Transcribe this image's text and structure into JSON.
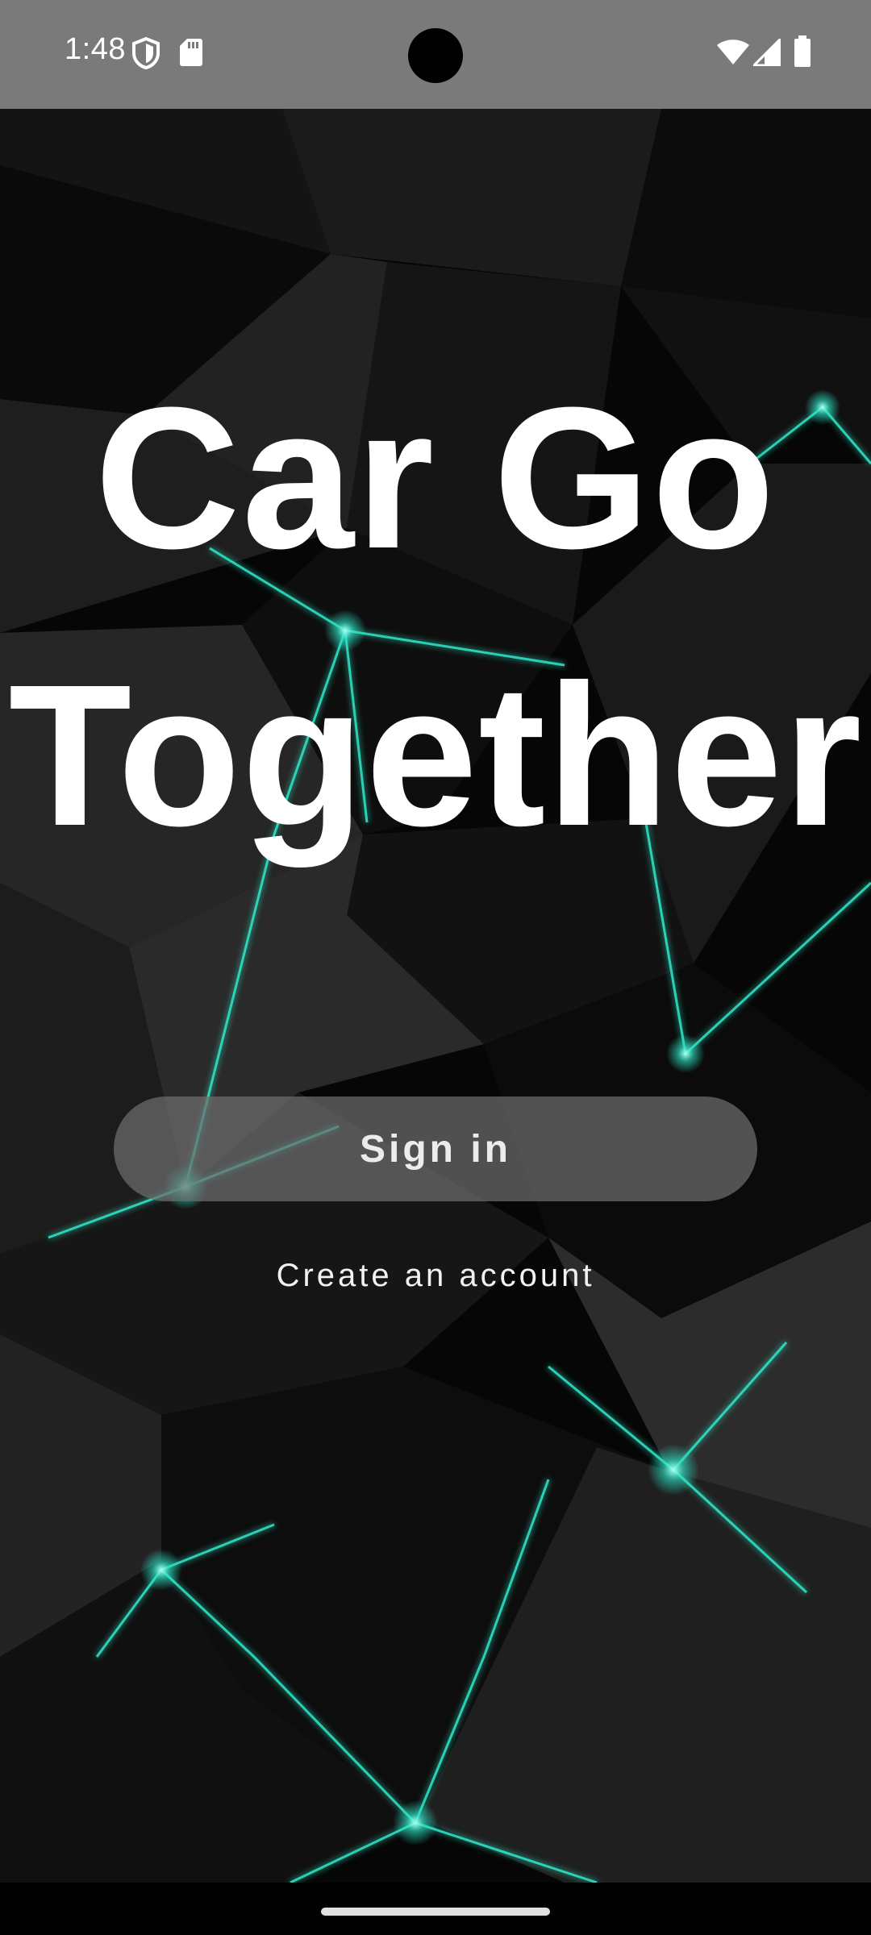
{
  "status_bar": {
    "time": "1:48",
    "left_icons": [
      "shield-icon",
      "sd-card-icon"
    ],
    "right_icons": [
      "wifi-icon",
      "cell-signal-icon",
      "battery-icon"
    ],
    "background": "#7a7a7a"
  },
  "title": {
    "line1": "Car Go",
    "line2": "Together"
  },
  "actions": {
    "sign_in_label": "Sign in",
    "create_account_label": "Create an account"
  },
  "colors": {
    "accent_glow": "#2ee6c8",
    "title_text": "#ffffff",
    "button_bg": "#6e6e6e"
  }
}
